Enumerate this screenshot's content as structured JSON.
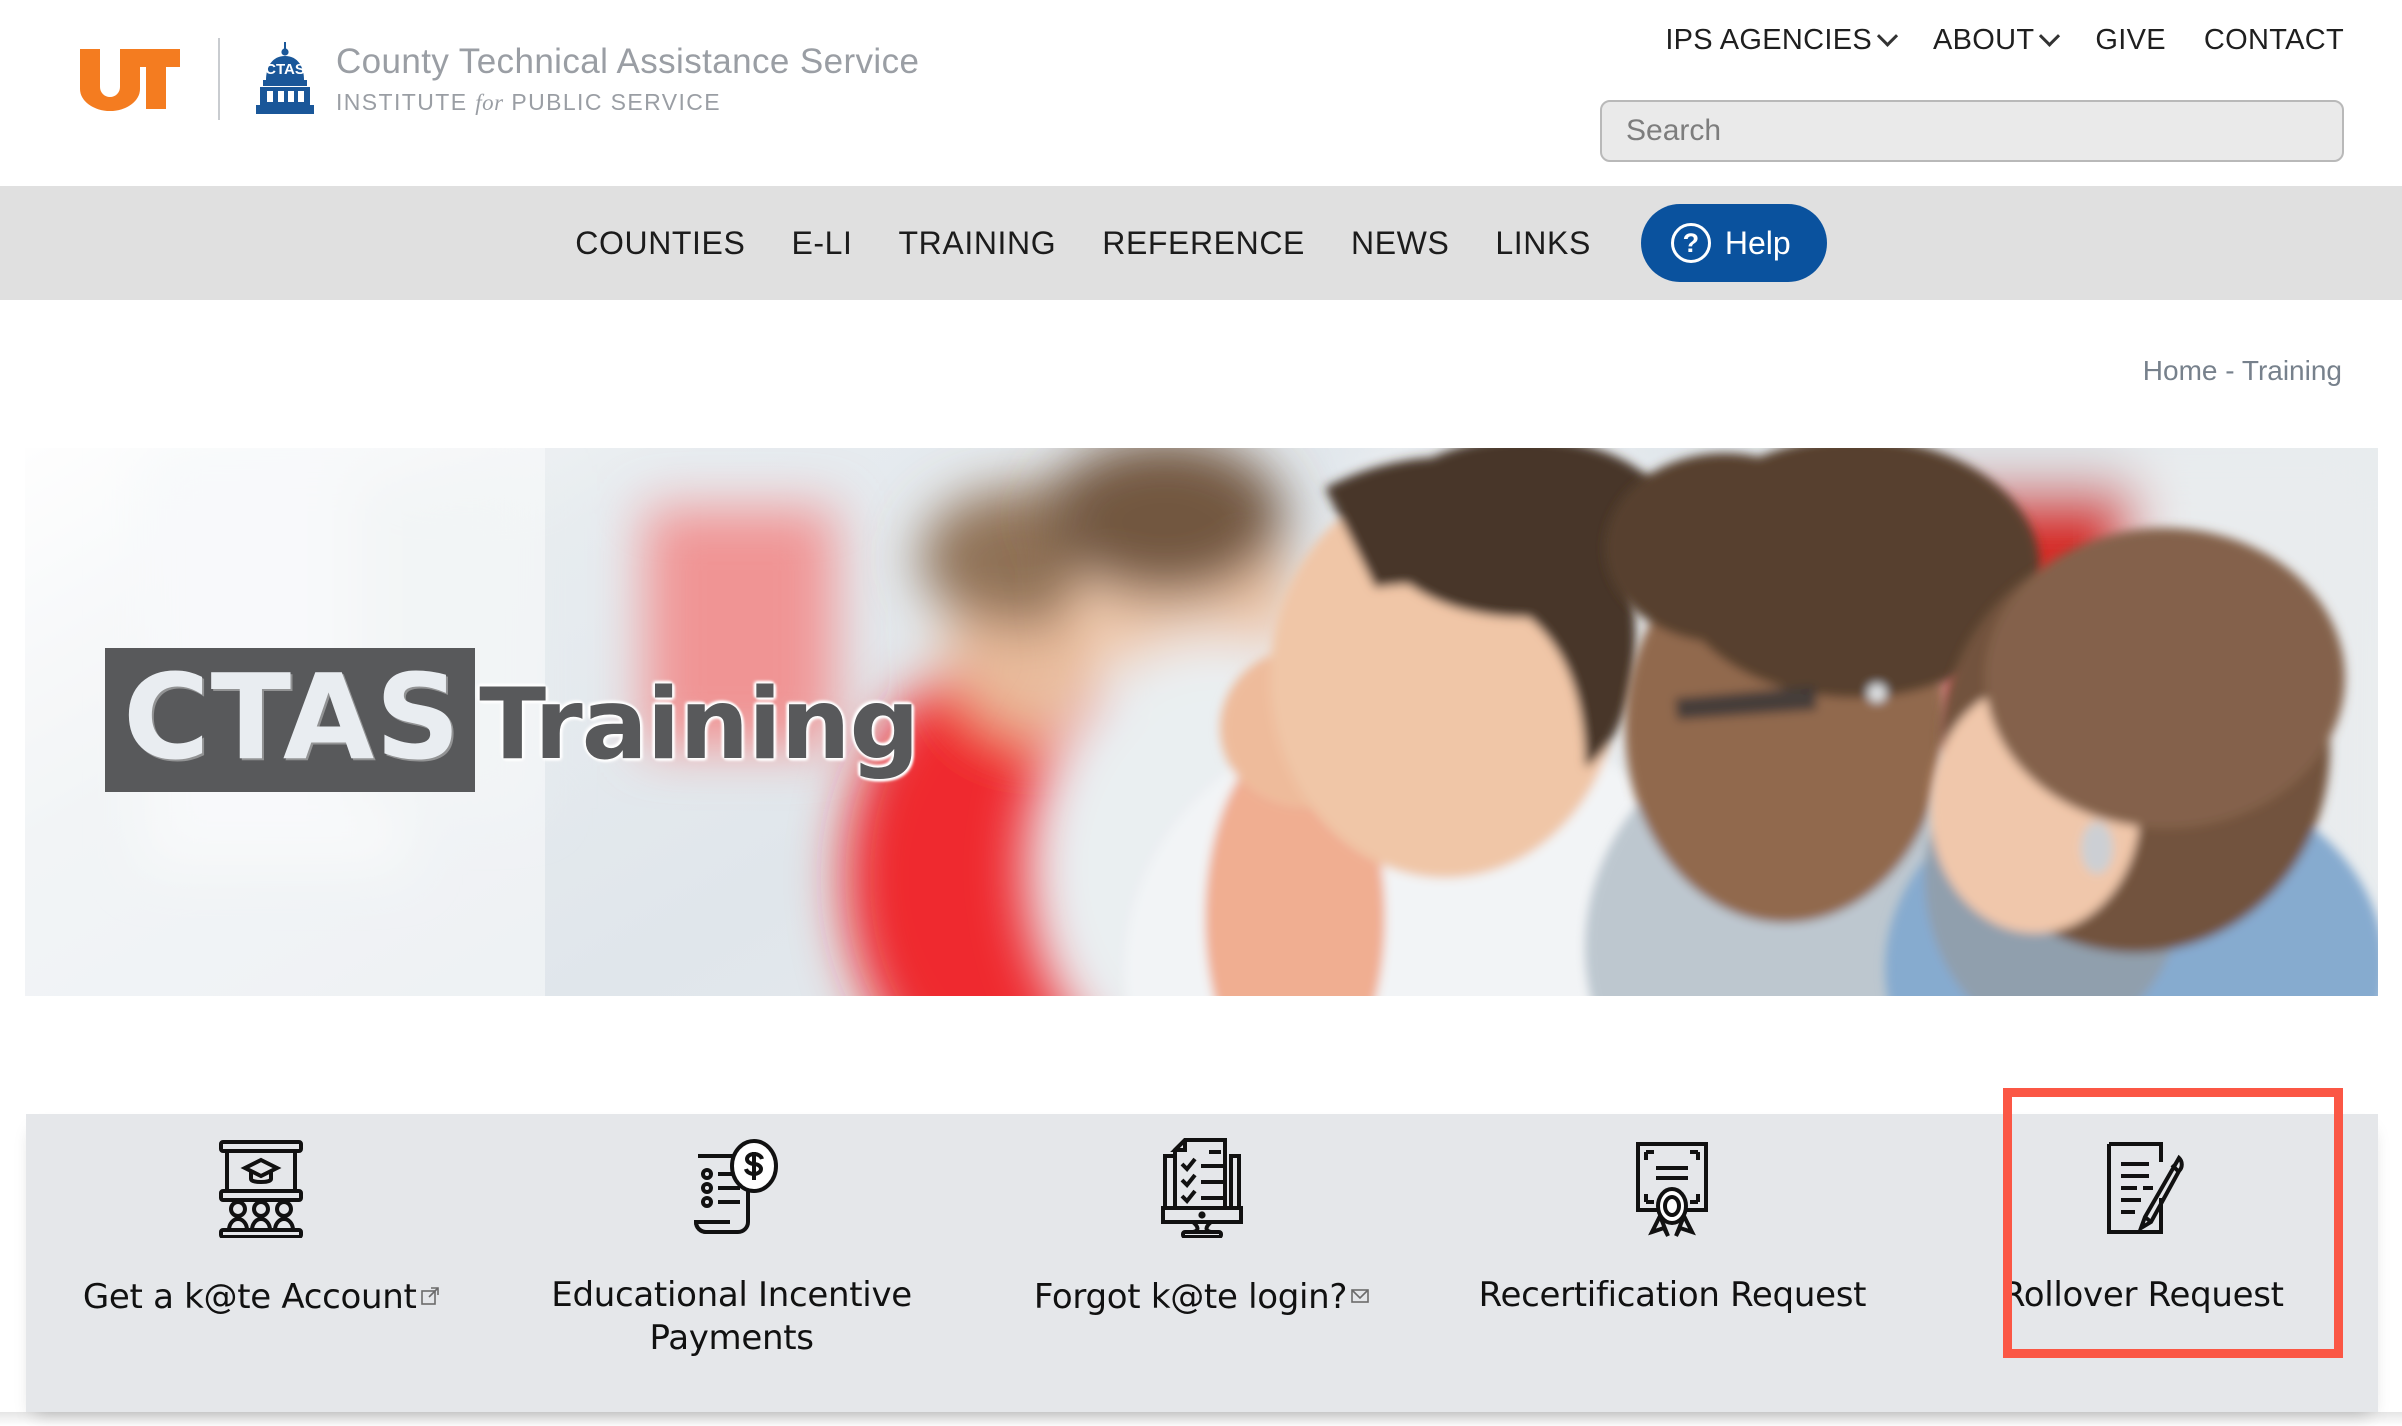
{
  "header": {
    "logo_ut_alt": "UT",
    "ctas_mark_text": "CTAS",
    "org_name": "County Technical Assistance Service",
    "org_subtitle_before": "INSTITUTE",
    "org_subtitle_italic": "for",
    "org_subtitle_after": "PUBLIC SERVICE",
    "utility_nav": [
      {
        "label": "IPS AGENCIES",
        "has_caret": true
      },
      {
        "label": "ABOUT",
        "has_caret": true
      },
      {
        "label": "GIVE",
        "has_caret": false
      },
      {
        "label": "CONTACT",
        "has_caret": false
      }
    ],
    "search": {
      "placeholder": "Search",
      "value": ""
    }
  },
  "main_nav": {
    "items": [
      {
        "label": "COUNTIES"
      },
      {
        "label": "E-LI"
      },
      {
        "label": "TRAINING"
      },
      {
        "label": "REFERENCE"
      },
      {
        "label": "NEWS"
      },
      {
        "label": "LINKS"
      }
    ],
    "help_button": {
      "label": "Help",
      "icon": "question-circle-icon",
      "glyph": "?",
      "background": "#0a529e"
    }
  },
  "breadcrumb": {
    "home": "Home",
    "separator": "-",
    "current": "Training",
    "full": "Home - Training"
  },
  "hero": {
    "caption_primary": "CTAS",
    "caption_secondary": "Training",
    "image_description": "Blurred photo of people working at computers in a classroom"
  },
  "tiles": [
    {
      "label": "Get a k@te Account",
      "icon": "presentation-training-icon",
      "trailing_icon": "external-link-icon",
      "highlighted": false
    },
    {
      "label": "Educational Incentive Payments",
      "icon": "invoice-dollar-icon",
      "trailing_icon": "",
      "highlighted": false
    },
    {
      "label": "Forgot k@te login?",
      "icon": "checklist-monitor-icon",
      "trailing_icon": "envelope-icon",
      "highlighted": false
    },
    {
      "label": "Recertification Request",
      "icon": "certificate-award-icon",
      "trailing_icon": "",
      "highlighted": false
    },
    {
      "label": "Rollover Request",
      "icon": "document-pencil-icon",
      "trailing_icon": "",
      "highlighted": true
    }
  ],
  "colors": {
    "ut_orange": "#f47c20",
    "ctas_blue": "#1a5799",
    "help_blue": "#0a529e",
    "navbar_gray": "#e0e0e0",
    "tile_bar_gray": "#e5e7ea",
    "highlight_red": "#fb5745",
    "brand_text_gray": "#9a9ea4",
    "breadcrumb_gray": "#77818c"
  }
}
